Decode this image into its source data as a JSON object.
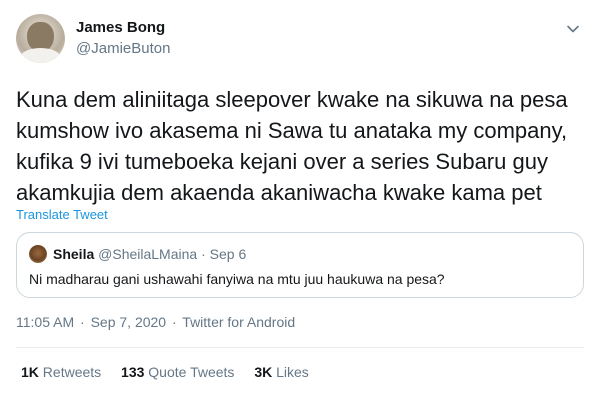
{
  "author": {
    "name": "James Bong",
    "handle": "@JamieButon"
  },
  "tweet": {
    "text": "Kuna dem aliniitaga sleepover kwake na sikuwa na pesa\nkumshow ivo akasema ni Sawa tu anataka my company,\nkufika 9 ivi tumeboeka kejani over a series  Subaru guy\nakamkujia dem akaenda  akaniwacha kwake kama pet",
    "translate_label": "Translate Tweet"
  },
  "quote": {
    "name": "Sheila",
    "handle": "@SheilaLMaina",
    "separator": "·",
    "date": "Sep 6",
    "text": "Ni madharau gani ushawahi fanyiwa na mtu juu haukuwa na pesa?"
  },
  "meta": {
    "time": "11:05 AM",
    "separator": "·",
    "date": "Sep 7, 2020",
    "source": "Twitter for Android"
  },
  "stats": {
    "retweets": {
      "count": "1K",
      "label": "Retweets"
    },
    "quotes": {
      "count": "133",
      "label": "Quote Tweets"
    },
    "likes": {
      "count": "3K",
      "label": "Likes"
    }
  },
  "icons": {
    "menu": "chevron-down-icon",
    "avatar": "avatar",
    "quote_avatar": "avatar"
  },
  "colors": {
    "text": "#14171a",
    "secondary": "#657786",
    "link": "#1b95e0",
    "border": "#ccd6dd"
  }
}
